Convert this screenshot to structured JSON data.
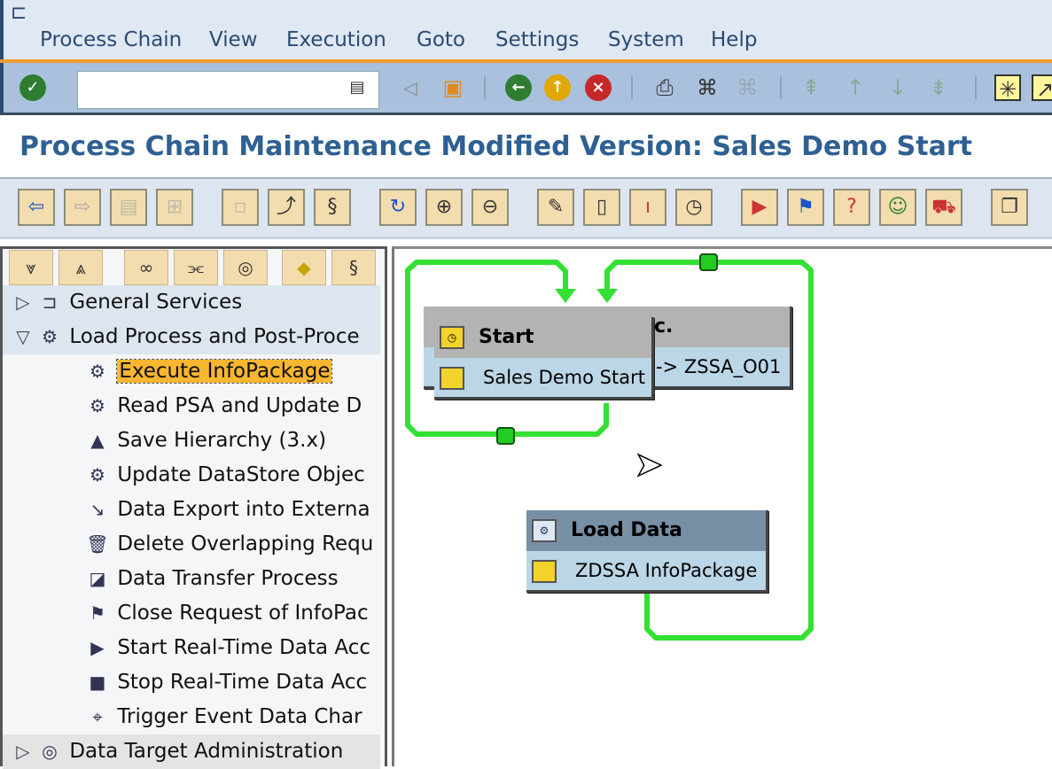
{
  "menu": {
    "items": [
      "Process Chain",
      "View",
      "Execution",
      "Goto",
      "Settings",
      "System",
      "Help"
    ]
  },
  "toolbar": {
    "command_field_value": ""
  },
  "title": "Process Chain Maintenance Modified Version: Sales Demo Start",
  "tree": {
    "items": [
      {
        "label": "General Services",
        "level": 1,
        "expanded": false,
        "icon": "general-services-icon"
      },
      {
        "label": "Load Process and Post-Proce",
        "level": 1,
        "expanded": true,
        "icon": "gear-box-icon"
      },
      {
        "label": "Execute InfoPackage",
        "level": 2,
        "selected": true,
        "icon": "gear-box-icon"
      },
      {
        "label": "Read PSA and Update D",
        "level": 2,
        "icon": "gear-check-icon"
      },
      {
        "label": "Save Hierarchy (3.x)",
        "level": 2,
        "icon": "hierarchy-icon"
      },
      {
        "label": "Update DataStore Objec",
        "level": 2,
        "icon": "gear-icon"
      },
      {
        "label": "Data Export into Externa",
        "level": 2,
        "icon": "export-icon"
      },
      {
        "label": "Delete Overlapping Requ",
        "level": 2,
        "icon": "trash-icon"
      },
      {
        "label": "Data Transfer Process",
        "level": 2,
        "icon": "dtp-icon"
      },
      {
        "label": "Close Request of InfoPac",
        "level": 2,
        "icon": "flag-icon"
      },
      {
        "label": "Start Real-Time Data Acc",
        "level": 2,
        "icon": "start-realtime-icon"
      },
      {
        "label": "Stop Real-Time Data Acc",
        "level": 2,
        "icon": "stop-realtime-icon"
      },
      {
        "label": "Trigger Event Data Char",
        "level": 2,
        "icon": "trigger-event-icon"
      },
      {
        "label": "Data Target Administration",
        "level": 1,
        "expanded": false,
        "icon": "target-icon"
      }
    ]
  },
  "canvas": {
    "hidden_node": {
      "title_fragment": "c.",
      "subtitle_fragment": "-> ZSSA_O01"
    },
    "start_node": {
      "title": "Start",
      "subtitle": "Sales Demo Start"
    },
    "load_node": {
      "title": "Load Data",
      "subtitle": "ZDSSA InfoPackage"
    },
    "link_color": "#33e033"
  },
  "colors": {
    "title": "#2e6092",
    "menu_accent": "#ee9a33",
    "selected": "#f8b631"
  }
}
